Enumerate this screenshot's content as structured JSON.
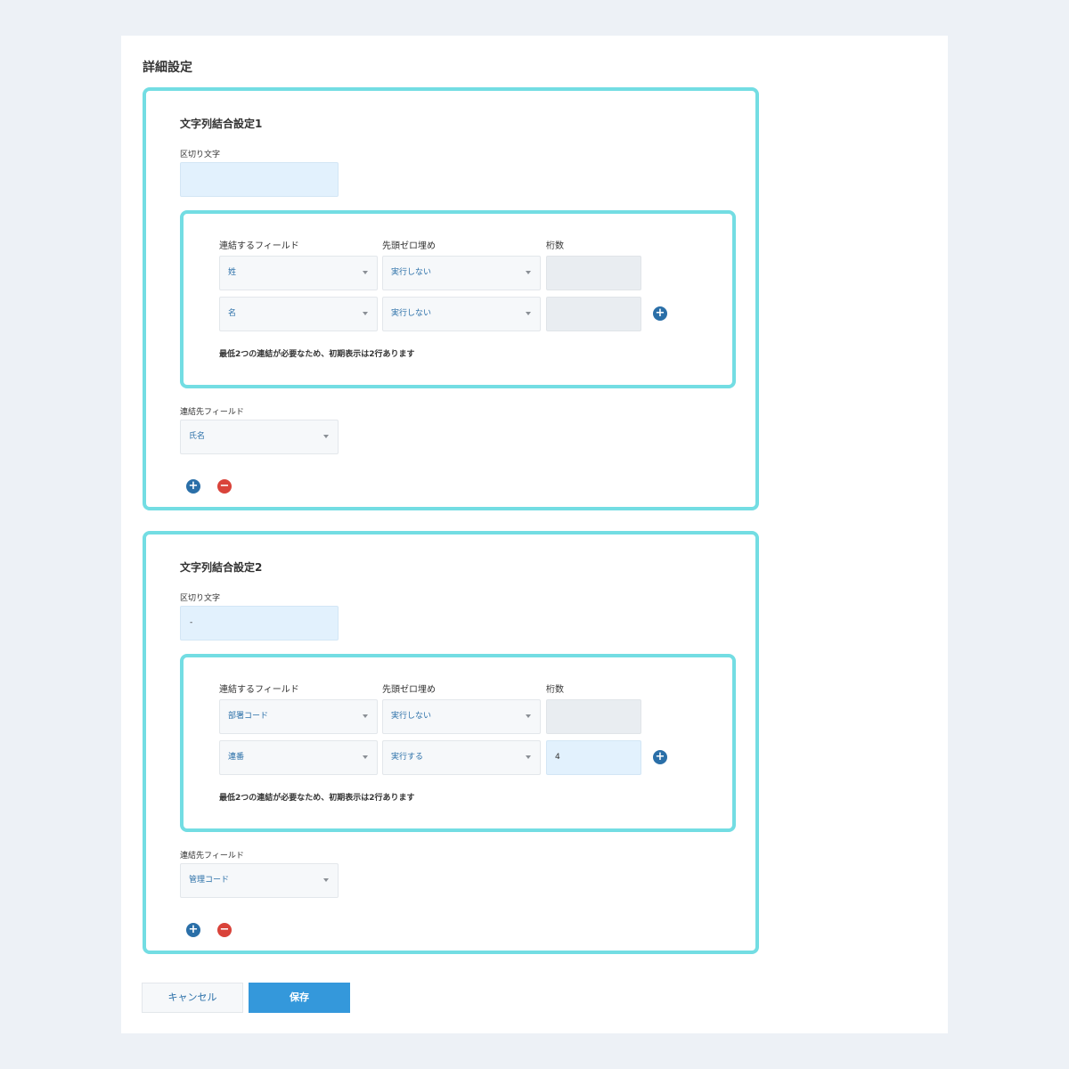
{
  "page": {
    "title": "詳細設定"
  },
  "settings": [
    {
      "title": "文字列結合設定1",
      "delimiter_label": "区切り文字",
      "delimiter_value": "",
      "headers": {
        "field": "連結するフィールド",
        "zero_pad": "先頭ゼロ埋め",
        "digits": "桁数"
      },
      "rows": [
        {
          "field": "姓",
          "zero_pad": "実行しない",
          "digits": ""
        },
        {
          "field": "名",
          "zero_pad": "実行しない",
          "digits": ""
        }
      ],
      "note": "最低2つの連結が必要なため、初期表示は2行あります",
      "target_label": "連結先フィールド",
      "target_value": "氏名"
    },
    {
      "title": "文字列結合設定2",
      "delimiter_label": "区切り文字",
      "delimiter_value": "-",
      "headers": {
        "field": "連結するフィールド",
        "zero_pad": "先頭ゼロ埋め",
        "digits": "桁数"
      },
      "rows": [
        {
          "field": "部署コード",
          "zero_pad": "実行しない",
          "digits": ""
        },
        {
          "field": "連番",
          "zero_pad": "実行する",
          "digits": "4"
        }
      ],
      "note": "最低2つの連結が必要なため、初期表示は2行あります",
      "target_label": "連結先フィールド",
      "target_value": "管理コード"
    }
  ],
  "icons": {
    "add": "plus-circle-icon",
    "remove": "minus-circle-icon",
    "dropdown": "caret-down-icon"
  },
  "colors": {
    "highlight_border": "#73dde3",
    "primary": "#3498db",
    "add": "#2a6fa8",
    "remove": "#d9433a"
  },
  "footer": {
    "cancel_label": "キャンセル",
    "save_label": "保存"
  }
}
